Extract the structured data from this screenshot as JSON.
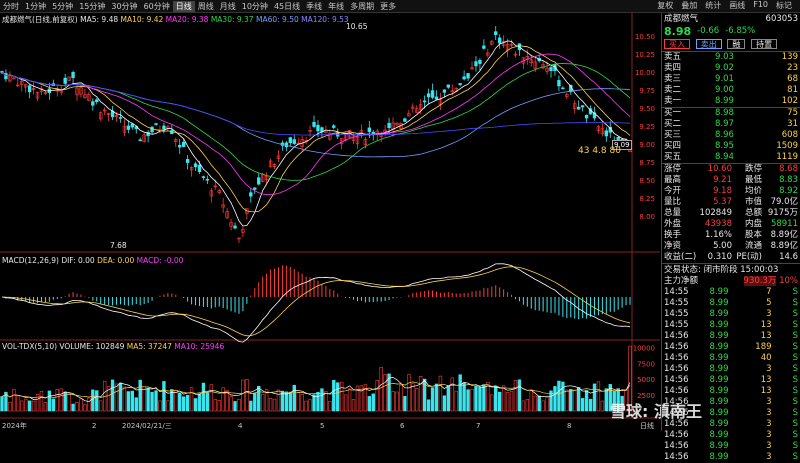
{
  "toolbar": {
    "items": [
      "分时",
      "1分钟",
      "5分钟",
      "15分钟",
      "30分钟",
      "60分钟",
      "日线",
      "周线",
      "月线",
      "10分钟",
      "45日线",
      "季线",
      "年线",
      "多周期",
      "更多"
    ],
    "active": "日线",
    "right": [
      "复权",
      "叠加",
      "统计",
      "画线",
      "F10",
      "标记"
    ]
  },
  "stock": {
    "name": "成都燃气",
    "code": "603053",
    "price": "8.98",
    "change": "-0.66",
    "pct": "-6.85%"
  },
  "indicators": {
    "ma_title": "成都燃气(日线,前复权)",
    "ma5": "MA5: 9.48",
    "ma10": "MA10: 9.42",
    "ma20": "MA20: 9.38",
    "ma30": "MA30: 9.37",
    "ma60": "MA60: 9.50",
    "ma120": "MA120: 9.53",
    "macd": "MACD(12,26,9)",
    "dif": "DIF: 0.00",
    "dea": "DEA: 0.00",
    "macd_val": "MACD: -0.00",
    "vol": "VOL-TDX(5,10)",
    "volume": "VOLUME: 102849",
    "vma5": "MA5: 37247",
    "vma10": "MA10: 25946"
  },
  "annotations": {
    "high": "10.65",
    "low": "7.68",
    "last": "9.09",
    "note": "43 4.8 80"
  },
  "axis": {
    "price_ticks": [
      "10.50",
      "10.25",
      "10.00",
      "9.75",
      "9.50",
      "9.25",
      "9.00",
      "8.75",
      "8.50",
      "8.25",
      "8.00"
    ],
    "vol_ticks": [
      "10000",
      "7500",
      "5000",
      "2500"
    ],
    "x_labels": [
      "2024年",
      "2",
      "2024/02/21/三",
      "4",
      "5",
      "6",
      "7",
      "8"
    ],
    "x_right": "日线"
  },
  "buttons": [
    "买入",
    "卖出",
    "融",
    "持置"
  ],
  "orderbook": {
    "asks": [
      [
        "卖五",
        "9.03",
        "139"
      ],
      [
        "卖四",
        "9.02",
        "23"
      ],
      [
        "卖三",
        "9.01",
        "68"
      ],
      [
        "卖二",
        "9.00",
        "81"
      ],
      [
        "卖一",
        "8.99",
        "102"
      ]
    ],
    "bids": [
      [
        "买一",
        "8.98",
        "75"
      ],
      [
        "买二",
        "8.97",
        "31"
      ],
      [
        "买三",
        "8.96",
        "608"
      ],
      [
        "买四",
        "8.95",
        "1509"
      ],
      [
        "买五",
        "8.94",
        "1119"
      ]
    ]
  },
  "quote": [
    [
      "涨停",
      "10.60",
      "跌停",
      "8.68"
    ],
    [
      "最高",
      "9.21",
      "最低",
      "8.83"
    ],
    [
      "今开",
      "9.18",
      "均价",
      "8.92"
    ],
    [
      "量比",
      "5.37",
      "市值",
      "79.0亿"
    ],
    [
      "总量",
      "102849",
      "总额",
      "9175万"
    ],
    [
      "外盘",
      "43938",
      "内盘",
      "58911"
    ],
    [
      "换手",
      "1.16%",
      "股本",
      "8.89亿"
    ],
    [
      "净资",
      "5.00",
      "流通",
      "8.89亿"
    ],
    [
      "收益(二)",
      "0.310",
      "PE(动)",
      "14.6"
    ]
  ],
  "trade_status": "交易状态: 闭市阶段 15:00:03",
  "fund_flow": {
    "label": "主力净额",
    "value": "930.3万",
    "pct": "10%"
  },
  "ticks": [
    [
      "14:55",
      "8.99",
      "7",
      "S"
    ],
    [
      "14:55",
      "8.99",
      "5",
      "S"
    ],
    [
      "14:55",
      "8.99",
      "3",
      "S"
    ],
    [
      "14:55",
      "8.99",
      "13",
      "S"
    ],
    [
      "14:56",
      "8.99",
      "13",
      "S"
    ],
    [
      "14:56",
      "8.99",
      "189",
      "S"
    ],
    [
      "14:56",
      "8.99",
      "40",
      "S"
    ],
    [
      "14:56",
      "8.99",
      "3",
      "S"
    ],
    [
      "14:56",
      "8.99",
      "13",
      "S"
    ],
    [
      "14:56",
      "8.99",
      "13",
      "S"
    ],
    [
      "14:56",
      "8.99",
      "3",
      "S"
    ],
    [
      "14:56",
      "8.99",
      "3",
      "S"
    ],
    [
      "14:56",
      "8.99",
      "3",
      "S"
    ],
    [
      "14:56",
      "8.99",
      "3",
      "S"
    ],
    [
      "14:56",
      "8.99",
      "3",
      "S"
    ],
    [
      "14:56",
      "8.99",
      "3",
      "S"
    ]
  ],
  "watermark": "雪球: 滇南王",
  "colors": {
    "up": "#ff3b3b",
    "down": "#38e6ee",
    "ma5": "#ffffff",
    "ma10": "#ffd24a",
    "ma20": "#ff38ff",
    "ma30": "#2fd94a",
    "ma60": "#6fa0ff",
    "ma120": "#4a4aff"
  }
}
